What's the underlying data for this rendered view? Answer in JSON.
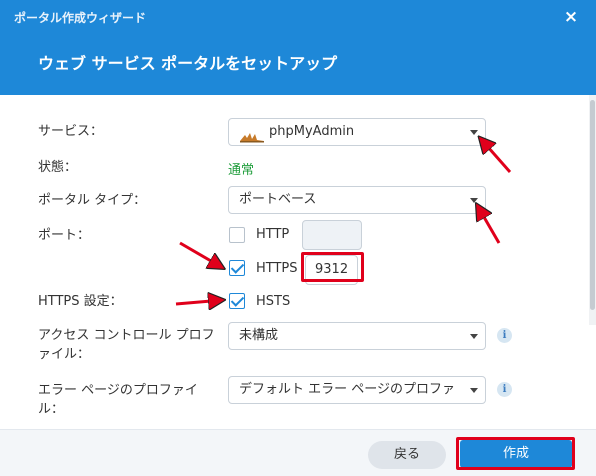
{
  "window": {
    "title": "ポータル作成ウィザード",
    "close_symbol": "×"
  },
  "heading": "ウェブ サービス ポータルをセットアップ",
  "form": {
    "service_label": "サービス：",
    "service_value": "phpMyAdmin",
    "status_label": "状態：",
    "status_value": "通常",
    "portal_type_label": "ポータル タイプ：",
    "portal_type_value": "ポートベース",
    "port_label": "ポート：",
    "http_label": "HTTP",
    "http_checked": false,
    "http_port": "",
    "https_label": "HTTPS",
    "https_checked": true,
    "https_port": "9312",
    "https_settings_label": "HTTPS 設定：",
    "hsts_label": "HSTS",
    "hsts_checked": true,
    "access_profile_label_1": "アクセス コントロール プロフ",
    "access_profile_label_2": "ァイル：",
    "access_profile_value": "未構成",
    "error_page_label_1": "エラー ページのプロファイ",
    "error_page_label_2": "ル：",
    "error_page_value": "デフォルト エラー ページのプロファ",
    "info_symbol": "i"
  },
  "footer": {
    "back_label": "戻る",
    "create_label": "作成"
  },
  "colors": {
    "header": "#1e88d8",
    "status_ok": "#1f9d3b",
    "annotation": "#e0001b"
  }
}
